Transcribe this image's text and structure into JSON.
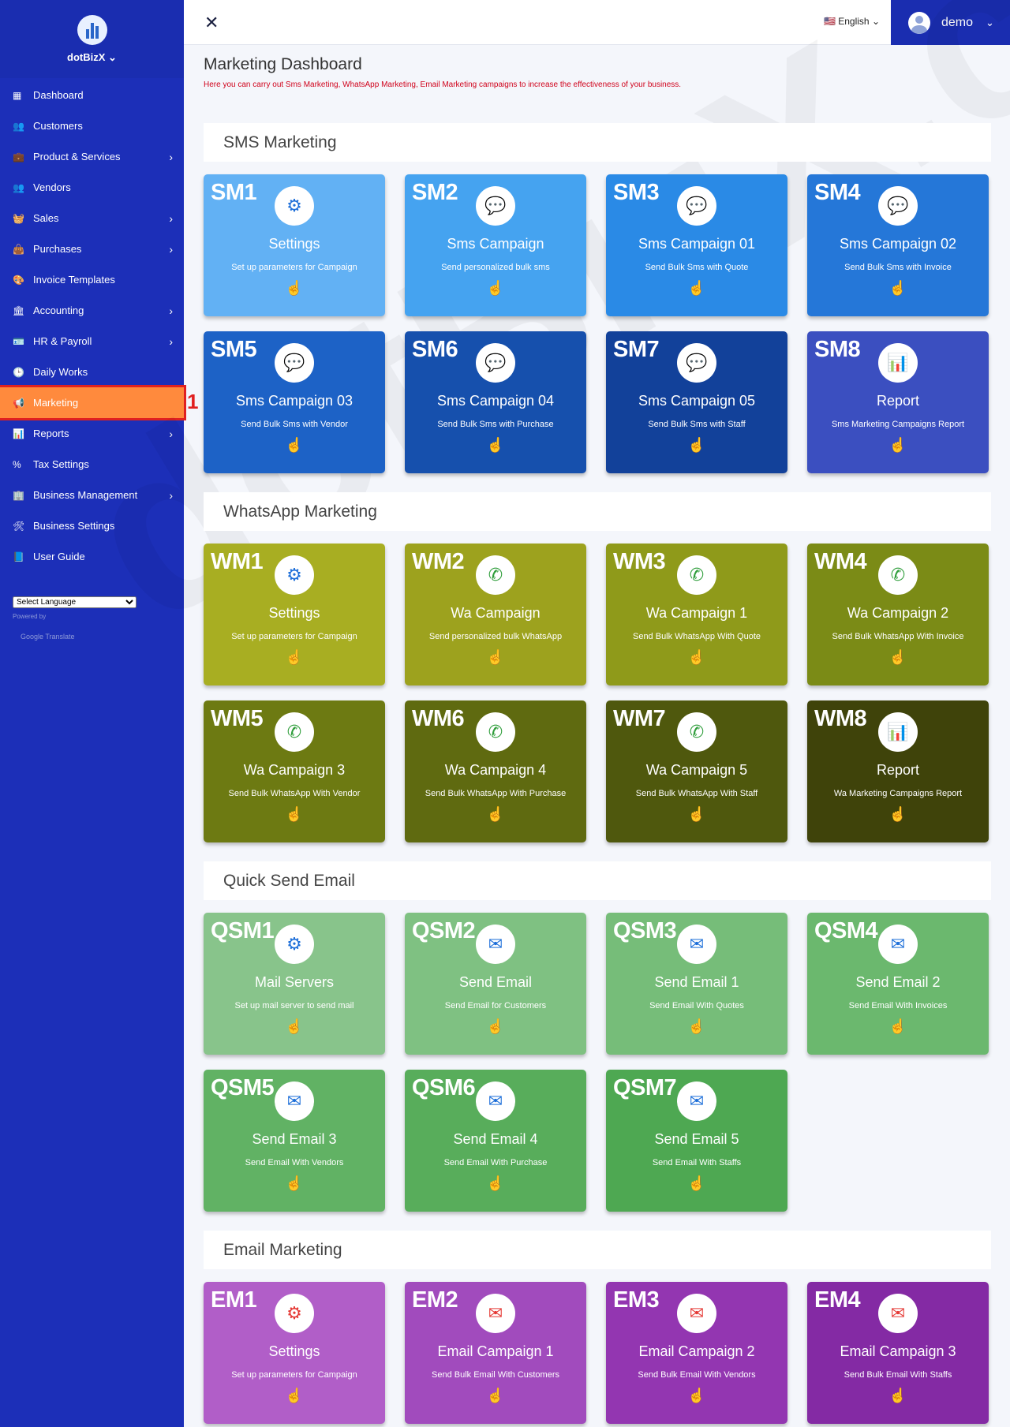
{
  "app": {
    "name": "dotBizX"
  },
  "sidebar": {
    "items": [
      {
        "label": "Dashboard",
        "icon": "dashboard-icon",
        "glyph": "▦",
        "chevron": false
      },
      {
        "label": "Customers",
        "icon": "users-icon",
        "glyph": "👥",
        "chevron": false
      },
      {
        "label": "Product & Services",
        "icon": "briefcase-icon",
        "glyph": "💼",
        "chevron": true
      },
      {
        "label": "Vendors",
        "icon": "users-icon",
        "glyph": "👥",
        "chevron": false
      },
      {
        "label": "Sales",
        "icon": "basket-icon",
        "glyph": "🧺",
        "chevron": true
      },
      {
        "label": "Purchases",
        "icon": "bag-icon",
        "glyph": "👜",
        "chevron": true
      },
      {
        "label": "Invoice Templates",
        "icon": "palette-icon",
        "glyph": "🎨",
        "chevron": false
      },
      {
        "label": "Accounting",
        "icon": "bank-icon",
        "glyph": "🏛",
        "chevron": true
      },
      {
        "label": "HR & Payroll",
        "icon": "id-card-icon",
        "glyph": "🪪",
        "chevron": true
      },
      {
        "label": "Daily Works",
        "icon": "clock-icon",
        "glyph": "🕒",
        "chevron": false
      },
      {
        "label": "Marketing",
        "icon": "megaphone-icon",
        "glyph": "📢",
        "chevron": false,
        "active": true
      },
      {
        "label": "Reports",
        "icon": "bar-chart-icon",
        "glyph": "📊",
        "chevron": true
      },
      {
        "label": "Tax Settings",
        "icon": "percent-icon",
        "glyph": "%",
        "chevron": false
      },
      {
        "label": "Business Management",
        "icon": "building-icon",
        "glyph": "🏢",
        "chevron": true
      },
      {
        "label": "Business Settings",
        "icon": "tools-icon",
        "glyph": "🛠",
        "chevron": false
      },
      {
        "label": "User Guide",
        "icon": "book-icon",
        "glyph": "📘",
        "chevron": false
      }
    ],
    "language_select": "Select Language",
    "powered_by": "Powered by",
    "google_translate": "Google Translate",
    "callout_number": "1"
  },
  "topbar": {
    "language": "English",
    "user": "demo"
  },
  "page": {
    "title": "Marketing Dashboard",
    "subtitle": "Here you can carry out Sms Marketing, WhatsApp Marketing, Email Marketing campaigns to increase the effectiveness of your business."
  },
  "watermark": "dotBizX.com",
  "sections": [
    {
      "title": "SMS Marketing",
      "cards": [
        {
          "code": "SM1",
          "title": "Settings",
          "desc": "Set up parameters for Campaign",
          "icon": "gear-icon",
          "glyph": "⚙",
          "icon_color": "#1e6fd9",
          "bg": "#62b1f4"
        },
        {
          "code": "SM2",
          "title": "Sms Campaign",
          "desc": "Send personalized bulk sms",
          "icon": "message-icon",
          "glyph": "💬",
          "icon_color": "#2e9d3a",
          "bg": "#45a3f0"
        },
        {
          "code": "SM3",
          "title": "Sms Campaign 01",
          "desc": "Send Bulk Sms with Quote",
          "icon": "message-icon",
          "glyph": "💬",
          "icon_color": "#e53935",
          "bg": "#2a8ae6"
        },
        {
          "code": "SM4",
          "title": "Sms Campaign 02",
          "desc": "Send Bulk Sms with Invoice",
          "icon": "message-icon",
          "glyph": "💬",
          "icon_color": "#8e24aa",
          "bg": "#2577d8"
        },
        {
          "code": "SM5",
          "title": "Sms Campaign 03",
          "desc": "Send Bulk Sms with Vendor",
          "icon": "message-icon",
          "glyph": "💬",
          "icon_color": "#6b7a1e",
          "bg": "#1d62c6"
        },
        {
          "code": "SM6",
          "title": "Sms Campaign 04",
          "desc": "Send Bulk Sms with Purchase",
          "icon": "message-icon",
          "glyph": "💬",
          "icon_color": "#f5a21b",
          "bg": "#1650ad"
        },
        {
          "code": "SM7",
          "title": "Sms Campaign 05",
          "desc": "Send Bulk Sms with Staff",
          "icon": "message-icon",
          "glyph": "💬",
          "icon_color": "#6d4c41",
          "bg": "#12419a"
        },
        {
          "code": "SM8",
          "title": "Report",
          "desc": "Sms Marketing Campaigns Report",
          "icon": "bar-chart-icon",
          "glyph": "📊",
          "icon_color": "#2c3db5",
          "bg": "#3b4fc0"
        }
      ]
    },
    {
      "title": "WhatsApp Marketing",
      "cards": [
        {
          "code": "WM1",
          "title": "Settings",
          "desc": "Set up parameters for Campaign",
          "icon": "gear-icon",
          "glyph": "⚙",
          "icon_color": "#1e6fd9",
          "bg": "#a8ae22"
        },
        {
          "code": "WM2",
          "title": "Wa Campaign",
          "desc": "Send personalized bulk WhatsApp",
          "icon": "whatsapp-icon",
          "glyph": "✆",
          "icon_color": "#2e9d3a",
          "bg": "#9da21e"
        },
        {
          "code": "WM3",
          "title": "Wa Campaign 1",
          "desc": "Send Bulk WhatsApp With Quote",
          "icon": "whatsapp-icon",
          "glyph": "✆",
          "icon_color": "#2e9d3a",
          "bg": "#8f9a1a"
        },
        {
          "code": "WM4",
          "title": "Wa Campaign 2",
          "desc": "Send Bulk WhatsApp With Invoice",
          "icon": "whatsapp-icon",
          "glyph": "✆",
          "icon_color": "#2e9d3a",
          "bg": "#7b8b16"
        },
        {
          "code": "WM5",
          "title": "Wa Campaign 3",
          "desc": "Send Bulk WhatsApp With Vendor",
          "icon": "whatsapp-icon",
          "glyph": "✆",
          "icon_color": "#2e9d3a",
          "bg": "#6d7a12"
        },
        {
          "code": "WM6",
          "title": "Wa Campaign 4",
          "desc": "Send Bulk WhatsApp With Purchase",
          "icon": "whatsapp-icon",
          "glyph": "✆",
          "icon_color": "#2e9d3a",
          "bg": "#5f6a10"
        },
        {
          "code": "WM7",
          "title": "Wa Campaign 5",
          "desc": "Send Bulk WhatsApp With Staff",
          "icon": "whatsapp-icon",
          "glyph": "✆",
          "icon_color": "#2e9d3a",
          "bg": "#4f580d"
        },
        {
          "code": "WM8",
          "title": "Report",
          "desc": "Wa Marketing Campaigns Report",
          "icon": "bar-chart-icon",
          "glyph": "📊",
          "icon_color": "#2c3db5",
          "bg": "#3f430a"
        }
      ]
    },
    {
      "title": "Quick Send Email",
      "cards": [
        {
          "code": "QSM1",
          "title": "Mail Servers",
          "desc": "Set up mail server to send mail",
          "icon": "gear-icon",
          "glyph": "⚙",
          "icon_color": "#1e6fd9",
          "bg": "#88c48b"
        },
        {
          "code": "QSM2",
          "title": "Send Email",
          "desc": "Send Email for Customers",
          "icon": "email-send-icon",
          "glyph": "✉",
          "icon_color": "#1e6fd9",
          "bg": "#7fc182"
        },
        {
          "code": "QSM3",
          "title": "Send Email 1",
          "desc": "Send Email With Quotes",
          "icon": "email-send-icon",
          "glyph": "✉",
          "icon_color": "#1e6fd9",
          "bg": "#76bd79"
        },
        {
          "code": "QSM4",
          "title": "Send Email 2",
          "desc": "Send Email With Invoices",
          "icon": "email-send-icon",
          "glyph": "✉",
          "icon_color": "#1e6fd9",
          "bg": "#6bb86e"
        },
        {
          "code": "QSM5",
          "title": "Send Email 3",
          "desc": "Send Email With Vendors",
          "icon": "email-send-icon",
          "glyph": "✉",
          "icon_color": "#1e6fd9",
          "bg": "#61b264"
        },
        {
          "code": "QSM6",
          "title": "Send Email 4",
          "desc": "Send Email With Purchase",
          "icon": "email-send-icon",
          "glyph": "✉",
          "icon_color": "#1e6fd9",
          "bg": "#58ad5b"
        },
        {
          "code": "QSM7",
          "title": "Send Email 5",
          "desc": "Send Email With Staffs",
          "icon": "email-send-icon",
          "glyph": "✉",
          "icon_color": "#1e6fd9",
          "bg": "#4ea852"
        }
      ]
    },
    {
      "title": "Email Marketing",
      "cards": [
        {
          "code": "EM1",
          "title": "Settings",
          "desc": "Set up parameters for Campaign",
          "icon": "gear-icon",
          "glyph": "⚙",
          "icon_color": "#e53935",
          "bg": "#b15ec8"
        },
        {
          "code": "EM2",
          "title": "Email Campaign 1",
          "desc": "Send Bulk Email With Customers",
          "icon": "email-send-icon",
          "glyph": "✉",
          "icon_color": "#e53935",
          "bg": "#a14bbd"
        },
        {
          "code": "EM3",
          "title": "Email Campaign 2",
          "desc": "Send Bulk Email With Vendors",
          "icon": "email-send-icon",
          "glyph": "✉",
          "icon_color": "#e53935",
          "bg": "#9336b1"
        },
        {
          "code": "EM4",
          "title": "Email Campaign 3",
          "desc": "Send Bulk Email With Staffs",
          "icon": "email-send-icon",
          "glyph": "✉",
          "icon_color": "#e53935",
          "bg": "#842aa4"
        }
      ]
    }
  ]
}
